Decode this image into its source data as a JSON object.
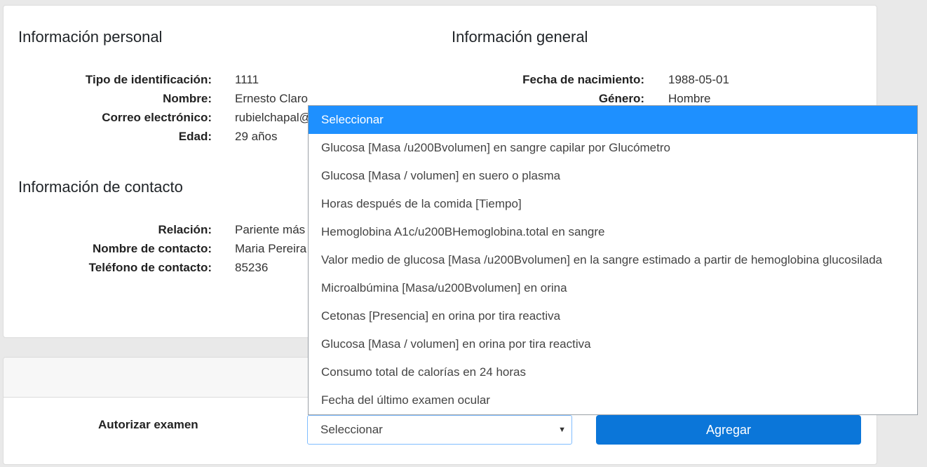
{
  "personal": {
    "title": "Información personal",
    "fields": [
      {
        "label": "Tipo de identificación:",
        "value": "1111"
      },
      {
        "label": "Nombre:",
        "value": "Ernesto Claro"
      },
      {
        "label": "Correo electrónico:",
        "value": "rubielchapal@"
      },
      {
        "label": "Edad:",
        "value": "29 años"
      }
    ]
  },
  "general": {
    "title": "Información general",
    "fields": [
      {
        "label": "Fecha de nacimiento:",
        "value": "1988-05-01"
      },
      {
        "label": "Género:",
        "value": "Hombre"
      }
    ]
  },
  "contact": {
    "title": "Información de contacto",
    "fields": [
      {
        "label": "Relación:",
        "value": "Pariente más"
      },
      {
        "label": "Nombre de contacto:",
        "value": "Maria Pereira"
      },
      {
        "label": "Teléfono de contacto:",
        "value": "85236"
      }
    ]
  },
  "exam": {
    "label": "Autorizar examen",
    "select_value": "Seleccionar",
    "add_button": "Agregar",
    "options": [
      "Seleccionar",
      "Glucosa [Masa /u200Bvolumen] en sangre capilar por Glucómetro",
      "Glucosa [Masa / volumen] en suero o plasma",
      "Horas después de la comida [Tiempo]",
      "Hemoglobina A1c/u200BHemoglobina.total en sangre",
      "Valor medio de glucosa [Masa /u200Bvolumen] en la sangre estimado a partir de hemoglobina glucosilada",
      "Microalbúmina [Masa/u200Bvolumen] en orina",
      "Cetonas [Presencia] en orina por tira reactiva",
      "Glucosa [Masa / volumen] en orina por tira reactiva",
      "Consumo total de calorías en 24 horas",
      "Fecha del último examen ocular"
    ]
  }
}
